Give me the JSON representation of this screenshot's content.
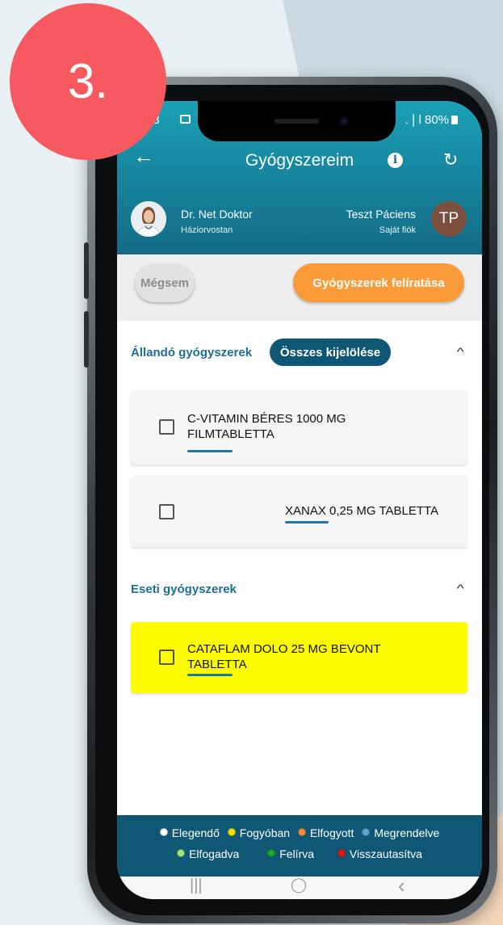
{
  "step_badge": "3.",
  "status_bar": {
    "time": "53",
    "right": "  .❘l 80%"
  },
  "topbar": {
    "title": "Gyógyszereim",
    "back_icon": "arrow-left-icon",
    "info_icon": "info-icon",
    "refresh_icon": "refresh-icon"
  },
  "doctor": {
    "name": "Dr. Net Doktor",
    "role": "Háziorvostan"
  },
  "patient": {
    "name": "Teszt Páciens",
    "account": "Saját fiók",
    "initials": "TP"
  },
  "actions": {
    "cancel": "Mégsem",
    "prescribe": "Gyógyszerek felíratása"
  },
  "permanent": {
    "title": "Állandó gyógyszerek",
    "select_all": "Összes kijelölése",
    "items": [
      {
        "line1": "C-VITAMIN BÉRES 1000 MG",
        "line2": "FILMTABLETTA"
      },
      {
        "line1": "XANAX 0,25 MG TABLETTA"
      }
    ]
  },
  "occasional": {
    "title": "Eseti gyógyszerek",
    "items": [
      {
        "line1": "CATAFLAM DOLO 25 MG BEVONT",
        "line2": "TABLETTA",
        "highlight": "#fdfd00"
      }
    ]
  },
  "legend": {
    "row1": [
      {
        "label": "Elegendő",
        "color": "#ffffff"
      },
      {
        "label": "Fogyóban",
        "color": "#f5e400"
      },
      {
        "label": "Elfogyott",
        "color": "#f48a3a"
      },
      {
        "label": "Megrendelve",
        "color": "#5aa7d8"
      }
    ],
    "row2": [
      {
        "label": "Elfogadva",
        "color": "#9be07a"
      },
      {
        "label": "Felírva",
        "color": "#1fa52b"
      },
      {
        "label": "Visszautasítva",
        "color": "#e21a1a"
      }
    ]
  },
  "navbar": {
    "recent": "|||",
    "home": "◯",
    "back": "‹"
  },
  "colors": {
    "header": "#1787a0",
    "accent_orange": "#fb9a39",
    "dark_teal": "#0f5775",
    "badge": "#f6595f"
  }
}
